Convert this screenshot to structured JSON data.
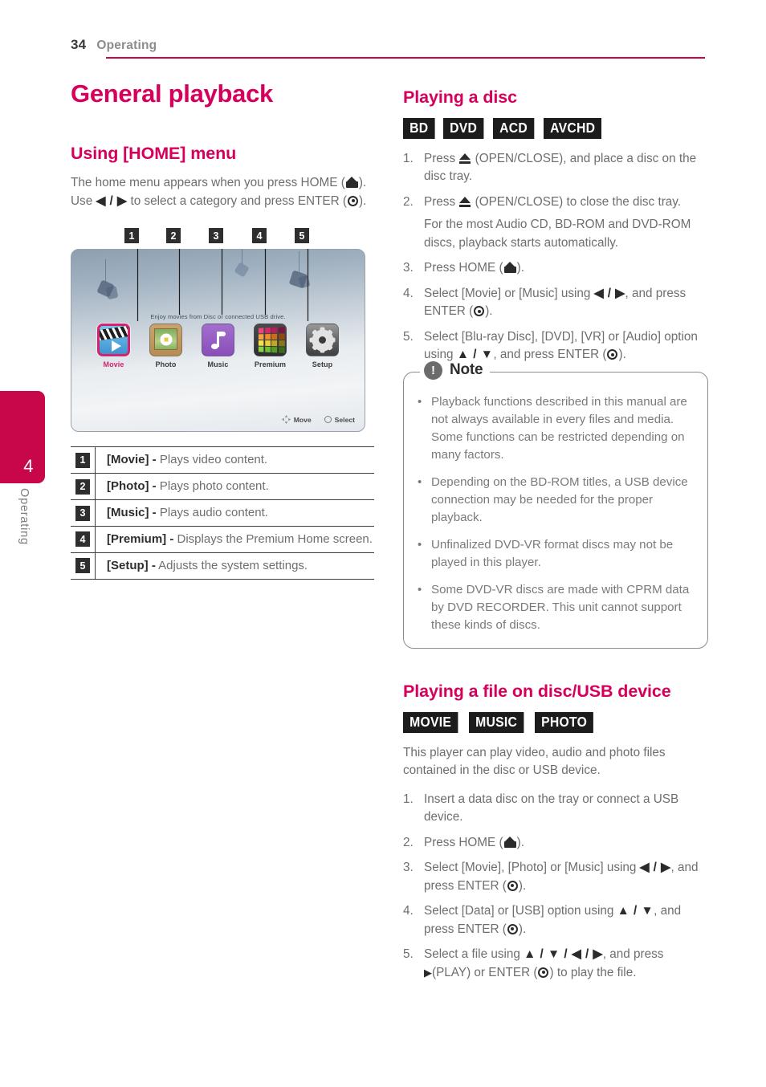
{
  "header": {
    "page_number": "34",
    "section": "Operating",
    "rule_color": "#c5083f"
  },
  "chapter_tab": {
    "number": "4",
    "label": "Operating",
    "color": "#c8064a"
  },
  "left_column": {
    "title": "General playback",
    "section_heading": "Using [HOME] menu",
    "intro_1": "The home menu appears when you press HOME",
    "intro_2": "). Use",
    "intro_arrows": "◀ / ▶",
    "intro_3": "to select a category and press",
    "intro_4": "ENTER (",
    "intro_5": ").",
    "callouts": [
      "1",
      "2",
      "3",
      "4",
      "5"
    ],
    "legend": [
      {
        "num": "1",
        "term": "[Movie] -",
        "desc": " Plays video content."
      },
      {
        "num": "2",
        "term": "[Photo] -",
        "desc": " Plays photo content."
      },
      {
        "num": "3",
        "term": "[Music] -",
        "desc": " Plays audio content."
      },
      {
        "num": "4",
        "term": "[Premium] -",
        "desc": " Displays the Premium Home screen."
      },
      {
        "num": "5",
        "term": "[Setup] -",
        "desc": " Adjusts the system settings."
      }
    ]
  },
  "figure": {
    "caption": "Enjoy movies from Disc or connected USB drive.",
    "menu_items": [
      {
        "label": "Movie",
        "icon": "movie-clapper-icon",
        "selected": true
      },
      {
        "label": "Photo",
        "icon": "photo-flower-icon",
        "selected": false
      },
      {
        "label": "Music",
        "icon": "music-note-icon",
        "selected": false
      },
      {
        "label": "Premium",
        "icon": "premium-grid-icon",
        "selected": false
      },
      {
        "label": "Setup",
        "icon": "setup-gear-icon",
        "selected": false
      }
    ],
    "hint_move": "Move",
    "hint_select": "Select"
  },
  "playing_disc": {
    "heading": "Playing a disc",
    "badges": [
      "BD",
      "DVD",
      "ACD",
      "AVCHD"
    ],
    "steps": [
      {
        "num": "1.",
        "pre": "Press ",
        "glyph": "eject",
        "post": " (OPEN/CLOSE), and place a disc on the disc tray."
      },
      {
        "num": "2.",
        "pre": "Press ",
        "glyph": "eject",
        "post": " (OPEN/CLOSE) to close the disc tray.",
        "extra": "For the most Audio CD, BD-ROM and DVD-ROM discs, playback starts automatically."
      },
      {
        "num": "3.",
        "pre": "Press HOME (",
        "glyph": "home",
        "post": ")."
      },
      {
        "num": "4.",
        "pre": "Select [Movie] or [Music] using ",
        "glyph": "lr-arrows",
        "post": ", and press ENTER (",
        "glyph2": "enter",
        "post2": ")."
      },
      {
        "num": "5.",
        "pre": "Select [Blu-ray Disc], [DVD], [VR] or [Audio] option using ",
        "glyph": "ud-arrows",
        "post": ", and press ENTER (",
        "glyph2": "enter",
        "post2": ")."
      }
    ],
    "note": {
      "title": "Note",
      "icon": "exclamation-icon",
      "bullets": [
        "Playback functions described in this manual are not always available in every files and media. Some functions can be restricted depending on many factors.",
        "Depending on the BD-ROM titles, a USB device connection may be needed for the proper playback.",
        "Unfinalized DVD-VR format discs may not be played in this player.",
        "Some DVD-VR discs are made with CPRM data by DVD RECORDER. This unit cannot support these kinds of discs."
      ]
    }
  },
  "playing_file": {
    "heading": "Playing a file on disc/USB device",
    "badges": [
      "MOVIE",
      "MUSIC",
      "PHOTO"
    ],
    "intro": "This player can play video, audio and photo files contained in the disc or USB device.",
    "steps": [
      {
        "num": "1.",
        "pre": "Insert a data disc on the tray or connect a USB device.",
        "glyph": "none",
        "post": ""
      },
      {
        "num": "2.",
        "pre": "Press HOME (",
        "glyph": "home",
        "post": ")."
      },
      {
        "num": "3.",
        "pre": "Select [Movie], [Photo] or [Music] using ",
        "glyph": "lr-arrows",
        "post": ", and press ENTER (",
        "glyph2": "enter",
        "post2": ")."
      },
      {
        "num": "4.",
        "pre": "Select [Data] or [USB] option using ",
        "glyph": "ud-arrows",
        "post": ", and press ENTER (",
        "glyph2": "enter",
        "post2": ")."
      },
      {
        "num": "5.",
        "pre": "Select a file using ",
        "glyph": "udlr-arrows",
        "post": ", and press ",
        "glyph2": "play",
        "post2": "(PLAY) or ENTER (",
        "glyph3": "enter",
        "post3": ") to play the file."
      }
    ]
  },
  "arrow_glyphs": {
    "lr": "◀ / ▶",
    "ud": "▲ / ▼",
    "udlr": "▲ / ▼ / ◀ / ▶",
    "play": "▶"
  }
}
